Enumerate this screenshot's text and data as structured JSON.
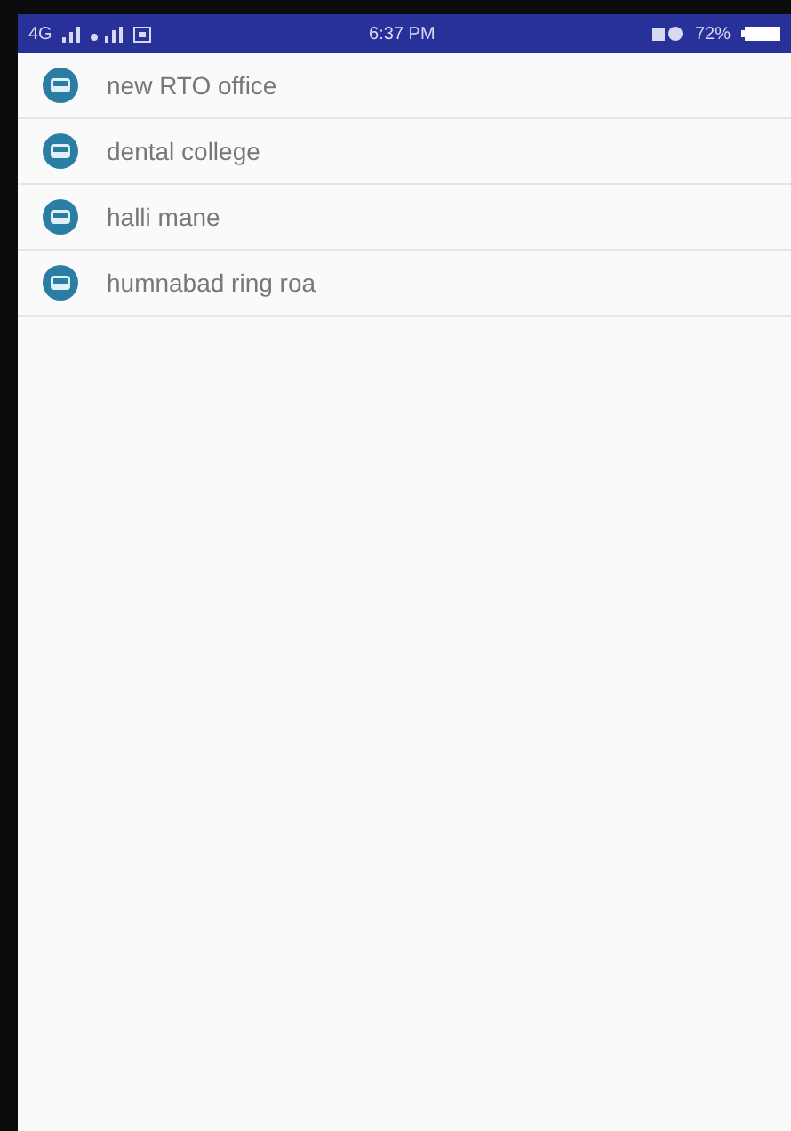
{
  "status_bar": {
    "network": "4G",
    "time": "6:37 PM",
    "battery": "72%"
  },
  "stops": [
    {
      "name": "new RTO office"
    },
    {
      "name": "dental college"
    },
    {
      "name": "halli mane"
    },
    {
      "name": "humnabad ring roa"
    }
  ]
}
